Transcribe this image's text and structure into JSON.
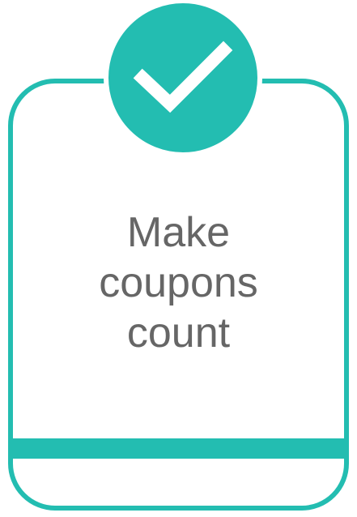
{
  "card": {
    "headline_lines": [
      "Make",
      "coupons",
      "count"
    ]
  },
  "badge": {
    "icon": "checkmark-icon"
  },
  "colors": {
    "accent": "#23bdb1",
    "text": "#666666",
    "background": "#ffffff"
  }
}
